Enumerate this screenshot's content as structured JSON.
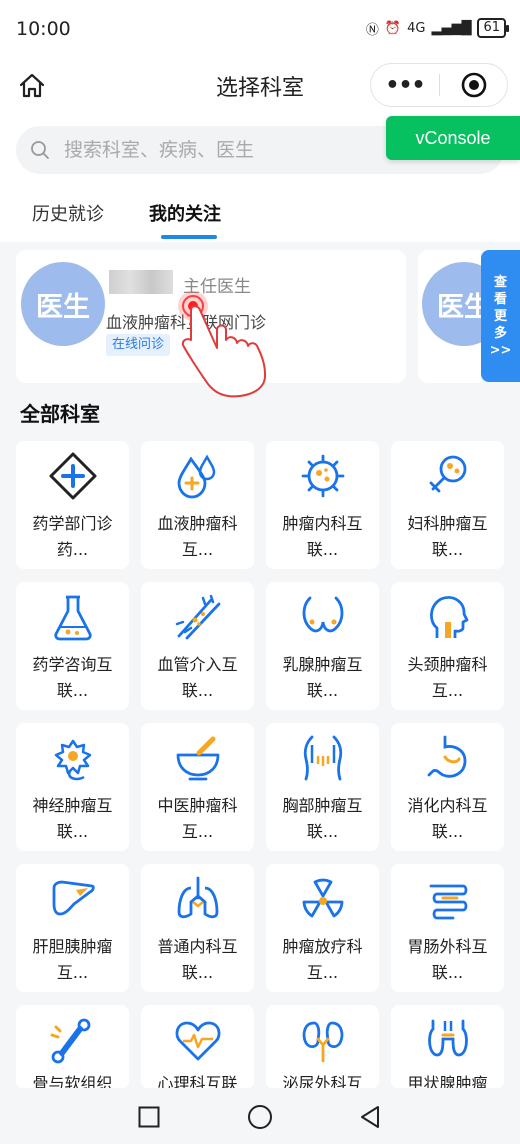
{
  "status_bar": {
    "time": "10:00",
    "network": "4G",
    "battery": "61"
  },
  "nav": {
    "title": "选择科室",
    "more_label": "•••"
  },
  "search": {
    "placeholder": "搜索科室、疾病、医生"
  },
  "vconsole_label": "vConsole",
  "tabs": [
    {
      "label": "历史就诊",
      "active": false
    },
    {
      "label": "我的关注",
      "active": true
    }
  ],
  "doctor_card": {
    "avatar_text": "医生",
    "title": "主任医生",
    "dept": "血液肿瘤科互联网门诊",
    "tag": "在线问诊"
  },
  "second_card_avatar": "医生",
  "view_more": [
    "查",
    "看",
    "更",
    "多",
    ">>"
  ],
  "section_title": "全部科室",
  "departments": [
    {
      "name": "药学部门诊药...",
      "icon": "pharmacy-cross-icon"
    },
    {
      "name": "血液肿瘤科互...",
      "icon": "blood-drop-icon"
    },
    {
      "name": "肿瘤内科互联...",
      "icon": "virus-cell-icon"
    },
    {
      "name": "妇科肿瘤互联...",
      "icon": "female-ovary-icon"
    },
    {
      "name": "药学咨询互联...",
      "icon": "flask-icon"
    },
    {
      "name": "血管介入互联...",
      "icon": "vessel-icon"
    },
    {
      "name": "乳腺肿瘤互联...",
      "icon": "breast-icon"
    },
    {
      "name": "头颈肿瘤科互...",
      "icon": "head-neck-icon"
    },
    {
      "name": "神经肿瘤互联...",
      "icon": "neuron-icon"
    },
    {
      "name": "中医肿瘤科互...",
      "icon": "mortar-pestle-icon"
    },
    {
      "name": "胸部肿瘤互联...",
      "icon": "chest-icon"
    },
    {
      "name": "消化内科互联...",
      "icon": "stomach-icon"
    },
    {
      "name": "肝胆胰肿瘤互...",
      "icon": "liver-icon"
    },
    {
      "name": "普通内科互联...",
      "icon": "lungs-icon"
    },
    {
      "name": "肿瘤放疗科互...",
      "icon": "radiation-icon"
    },
    {
      "name": "胃肠外科互联...",
      "icon": "intestine-icon"
    },
    {
      "name": "骨与软组织",
      "icon": "bone-icon"
    },
    {
      "name": "心理科互联",
      "icon": "heart-pulse-icon"
    },
    {
      "name": "泌尿外科互",
      "icon": "kidney-icon"
    },
    {
      "name": "甲状腺肿瘤",
      "icon": "thyroid-icon"
    }
  ],
  "colors": {
    "accent": "#1e88e5",
    "icon_blue": "#1a73e8",
    "icon_orange": "#f5a623",
    "vconsole": "#07c160"
  }
}
